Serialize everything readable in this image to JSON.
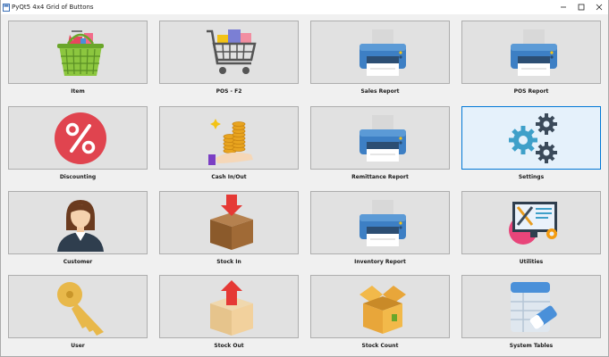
{
  "window": {
    "title": "PyQt5 4x4 Grid of Buttons",
    "controls": [
      "minimize-icon",
      "maximize-icon",
      "close-icon"
    ]
  },
  "buttons": [
    {
      "label": "Item",
      "icon": "shopping-basket-icon"
    },
    {
      "label": "POS - F2",
      "icon": "shopping-cart-icon"
    },
    {
      "label": "Sales Report",
      "icon": "printer-icon"
    },
    {
      "label": "POS Report",
      "icon": "printer-icon"
    },
    {
      "label": "Discounting",
      "icon": "percent-badge-icon"
    },
    {
      "label": "Cash In/Out",
      "icon": "coins-hand-icon"
    },
    {
      "label": "Remittance Report",
      "icon": "printer-icon"
    },
    {
      "label": "Settings",
      "icon": "gears-icon"
    },
    {
      "label": "Customer",
      "icon": "customer-avatar-icon"
    },
    {
      "label": "Stock In",
      "icon": "box-arrow-in-icon"
    },
    {
      "label": "Inventory Report",
      "icon": "printer-icon"
    },
    {
      "label": "Utilities",
      "icon": "monitor-tools-icon"
    },
    {
      "label": "User",
      "icon": "key-icon"
    },
    {
      "label": "Stock Out",
      "icon": "box-arrow-out-icon"
    },
    {
      "label": "Stock Count",
      "icon": "open-box-icon"
    },
    {
      "label": "System Tables",
      "icon": "table-eraser-icon"
    }
  ],
  "focused_button": "Settings"
}
